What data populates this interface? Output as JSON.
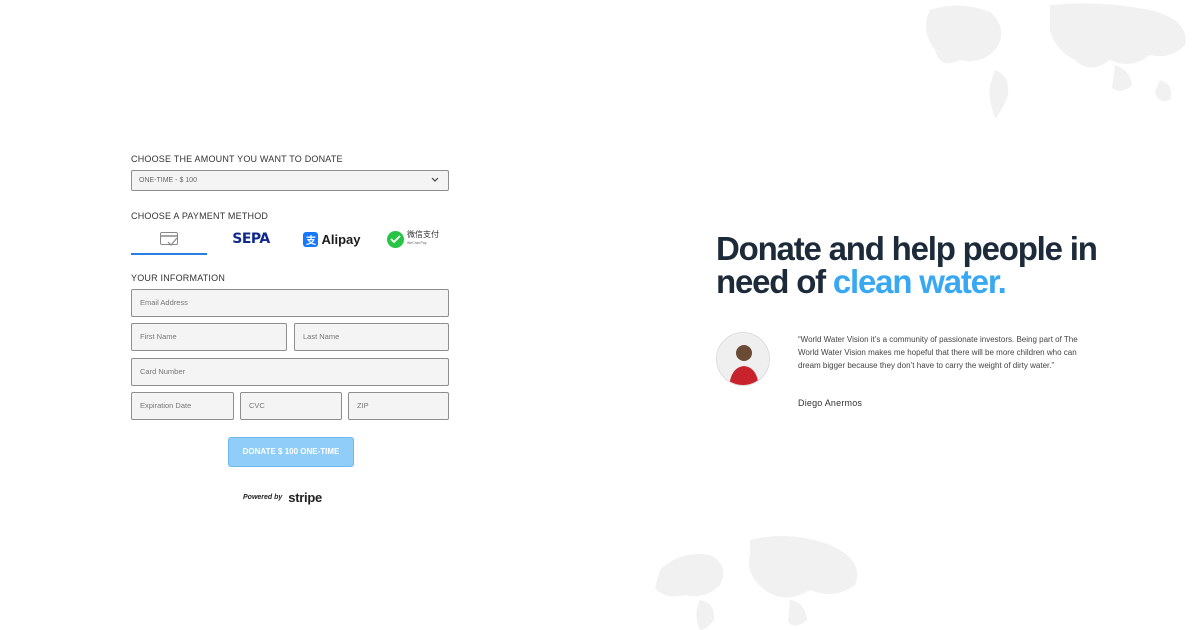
{
  "form": {
    "amount_label": "CHOOSE THE AMOUNT YOU WANT TO DONATE",
    "amount_selected": "ONE-TIME - $ 100",
    "payment_label": "CHOOSE A PAYMENT METHOD",
    "payment_methods": {
      "card": "card",
      "sepa": "SEPA",
      "alipay": "Alipay",
      "wechat": "微信支付",
      "wechat_sub": "WeChat Pay"
    },
    "info_label": "YOUR INFORMATION",
    "placeholders": {
      "email": "Email Address",
      "first_name": "First Name",
      "last_name": "Last Name",
      "card_number": "Card Number",
      "expiration": "Expiration Date",
      "cvc": "CVC",
      "zip": "ZIP"
    },
    "donate_button": "DONATE $ 100 ONE-TIME",
    "powered_by": "Powered by",
    "stripe": "stripe"
  },
  "hero": {
    "headline_part1": "Donate and help people in need of",
    "headline_accent": "clean water."
  },
  "testimonial": {
    "quote": "“World Water Vision it’s a community of passionate investors. Being part of The World Water Vision makes me hopeful that there will be more children who can dream bigger because they don’t have to carry the weight of dirty water.”",
    "author": "Diego Anermos"
  },
  "colors": {
    "accent": "#38a8f2",
    "button": "#90cdf8",
    "tab_active": "#2a7de1",
    "headline": "#1c2a3a"
  }
}
